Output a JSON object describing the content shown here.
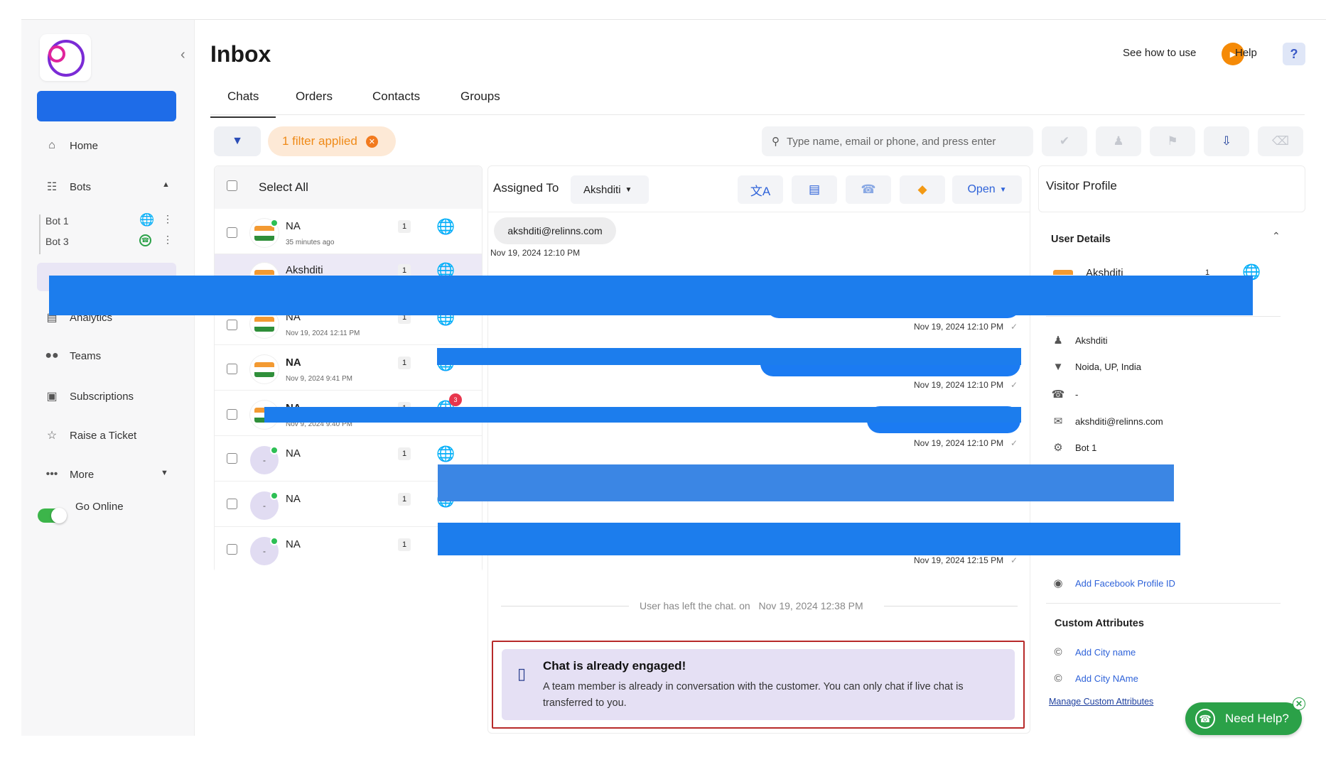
{
  "header": {
    "title": "Inbox",
    "see_how": "See how to use",
    "help": "Help",
    "help_q": "?"
  },
  "tabs": [
    {
      "label": "Chats"
    },
    {
      "label": "Orders"
    },
    {
      "label": "Contacts"
    },
    {
      "label": "Groups"
    }
  ],
  "sidebar": {
    "items": [
      {
        "label": "Home",
        "icon": "home-icon"
      },
      {
        "label": "Bots",
        "icon": "bots-icon"
      },
      {
        "label": "Analytics",
        "icon": "analytics-icon"
      },
      {
        "label": "Teams",
        "icon": "teams-icon"
      },
      {
        "label": "Subscriptions",
        "icon": "subscriptions-icon"
      },
      {
        "label": "Raise a Ticket",
        "icon": "ticket-icon"
      },
      {
        "label": "More",
        "icon": "more-icon"
      }
    ],
    "bots": [
      {
        "name": "Bot 1",
        "channel": "web"
      },
      {
        "name": "Bot 3",
        "channel": "whatsapp"
      }
    ],
    "go_online": "Go Online"
  },
  "toolbar": {
    "filter_applied": "1 filter applied",
    "search_placeholder": "Type name, email or phone, and press enter"
  },
  "chat_list": {
    "select_all": "Select All",
    "rows": [
      {
        "name": "NA",
        "time": "35 minutes ago",
        "count": "1"
      },
      {
        "name": "Akshditi",
        "time": "",
        "count": "1"
      },
      {
        "name": "NA",
        "time": "Nov 19, 2024 12:11 PM",
        "count": "1"
      },
      {
        "name": "NA",
        "time": "Nov 9, 2024 9:41 PM",
        "count": "1"
      },
      {
        "name": "NA",
        "time": "Nov 9, 2024 9:40 PM",
        "count": "1",
        "badge": "3"
      },
      {
        "name": "NA",
        "time": "",
        "count": "1",
        "avatar": "-"
      },
      {
        "name": "NA",
        "time": "",
        "count": "1",
        "avatar": "-"
      },
      {
        "name": "NA",
        "time": "",
        "count": "1",
        "avatar": "-"
      }
    ]
  },
  "conversation": {
    "assigned_to_label": "Assigned To",
    "assignee": "Akshditi",
    "status": "Open",
    "email_chip": "akshditi@relinns.com",
    "first_time": "Nov 19, 2024 12:10 PM",
    "message_times": [
      "Nov 19, 2024 12:10 PM",
      "Nov 19, 2024 12:10 PM",
      "Nov 19, 2024 12:10 PM",
      "Nov 19, 2024 12:15 PM"
    ],
    "left_text": "User has left the chat. on",
    "left_time": "Nov 19, 2024 12:38 PM",
    "engaged_title": "Chat is already engaged!",
    "engaged_body": "A team member is already in conversation with the customer. You can only chat if live chat is transferred to you."
  },
  "visitor": {
    "title": "Visitor Profile",
    "user_details": "User Details",
    "name_header": "Akshditi",
    "count": "1",
    "name": "Akshditi",
    "location": "Noida, UP, India",
    "phone": "-",
    "email": "akshditi@relinns.com",
    "bot": "Bot 1",
    "facebook": "Add Facebook Profile ID",
    "custom_attributes": "Custom Attributes",
    "attrs": [
      "Add City name",
      "Add City NAme"
    ],
    "manage": "Manage Custom Attributes"
  },
  "need_help": "Need Help?",
  "colors": {
    "accent": "#2f63d9",
    "redaction": "#1c7ded",
    "online": "#2dbf54",
    "orange": "#f58a07",
    "need_help": "#2ba148"
  }
}
